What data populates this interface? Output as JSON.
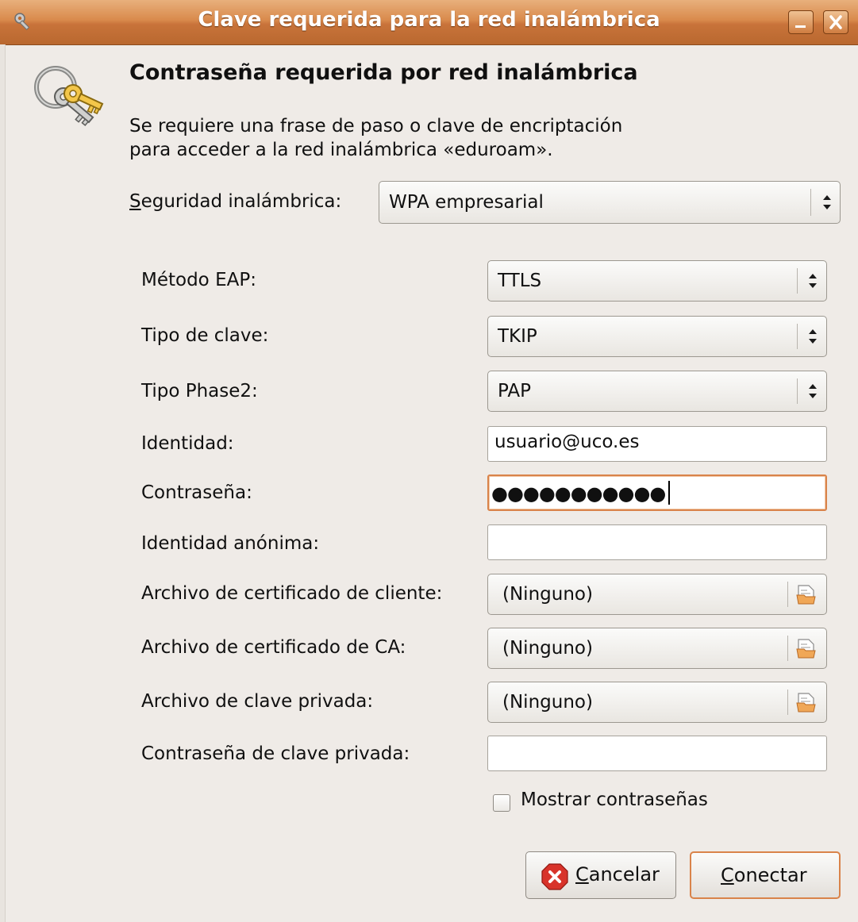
{
  "window": {
    "title": "Clave requerida para la red inalámbrica"
  },
  "header": {
    "heading": "Contraseña requerida por red inalámbrica",
    "description_line1": "Se requiere una frase de paso o clave de encriptación",
    "description_line2": "para acceder a la red inalámbrica «eduroam»."
  },
  "security": {
    "label_mnemonic": "S",
    "label_rest": "eguridad inalámbrica:",
    "value": "WPA empresarial"
  },
  "fields": {
    "eap_method": {
      "label": "Método EAP:",
      "value": "TTLS"
    },
    "key_type": {
      "label": "Tipo de clave:",
      "value": "TKIP"
    },
    "phase2_type": {
      "label": "Tipo Phase2:",
      "value": "PAP"
    },
    "identity": {
      "label": "Identidad:",
      "value": "usuario@uco.es"
    },
    "password": {
      "label": "Contraseña:",
      "masked_value": "●●●●●●●●●●●"
    },
    "anonymous_identity": {
      "label": "Identidad anónima:",
      "value": ""
    },
    "client_cert": {
      "label": "Archivo de certificado de cliente:",
      "value": "(Ninguno)"
    },
    "ca_cert": {
      "label": "Archivo de certificado de CA:",
      "value": "(Ninguno)"
    },
    "private_key": {
      "label": "Archivo de clave privada:",
      "value": "(Ninguno)"
    },
    "private_key_password": {
      "label": "Contraseña de clave privada:",
      "value": ""
    }
  },
  "show_passwords": {
    "label": "Mostrar contraseñas",
    "checked": false
  },
  "buttons": {
    "cancel_mnemonic": "C",
    "cancel_rest": "ancelar",
    "connect_mnemonic": "C",
    "connect_rest": "onectar"
  },
  "icons": {
    "title": "key-icon",
    "header": "keyring-icon",
    "cancel": "cancel-icon",
    "file": "file-open-icon"
  },
  "colors": {
    "titlebar": "#d98a4c",
    "focus": "#d9834a",
    "cancel_icon": "#d8332a"
  }
}
